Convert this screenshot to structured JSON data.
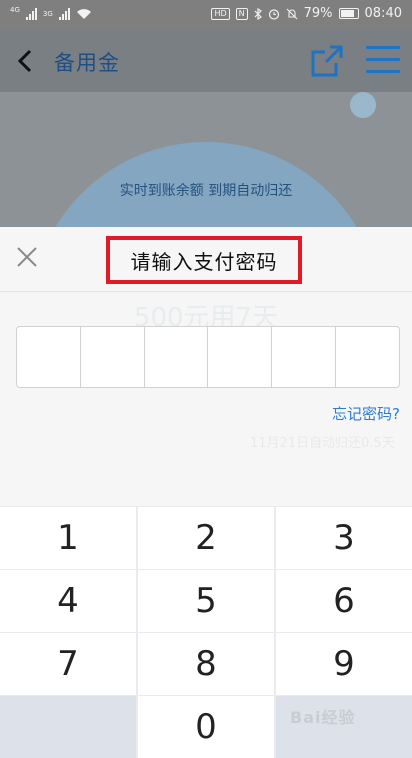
{
  "status_bar": {
    "left_labels": [
      "4G",
      "3G"
    ],
    "hd_badge": "HD",
    "battery": "79%",
    "time": "08:40"
  },
  "app_header": {
    "title": "备用金",
    "background_text": "实时到账余额 到期自动归还"
  },
  "payment_sheet": {
    "title": "请输入支付密码",
    "ghost_line": "500元用7天",
    "ghost_line_small": "11月21日自动归还0.5天",
    "pin_length": 6,
    "forgot_link": "忘记密码?"
  },
  "keypad": {
    "keys": [
      "1",
      "2",
      "3",
      "4",
      "5",
      "6",
      "7",
      "8",
      "9",
      "0"
    ]
  },
  "watermark": "Bai经验",
  "colors": {
    "highlight_border": "#e01a26",
    "link": "#2e7bd6",
    "app_brand": "#1e73c5"
  }
}
